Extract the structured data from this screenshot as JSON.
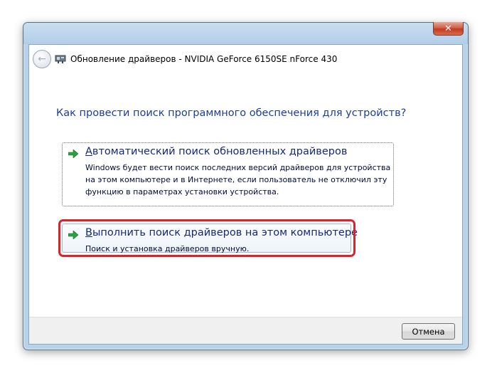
{
  "window": {
    "title": "Обновление драйверов - NVIDIA GeForce 6150SE nForce 430",
    "close_glyph": "✕"
  },
  "nav": {
    "back_glyph": "←"
  },
  "main_instruction": "Как провести поиск программного обеспечения для устройств?",
  "options": [
    {
      "title_underlined": "А",
      "title_rest": "втоматический поиск обновленных драйверов",
      "description": "Windows будет вести поиск последних версий драйверов для устройства на этом компьютере и в Интернете, если пользователь не отключил эту функцию в параметрах установки устройства."
    },
    {
      "title_underlined": "В",
      "title_rest": "ыполнить поиск драйверов на этом компьютере",
      "description": "Поиск и установка драйверов вручную."
    }
  ],
  "buttons": {
    "cancel": "Отмена"
  },
  "colors": {
    "instruction": "#1a3e9c",
    "option_title": "#14287a",
    "arrow_green": "#2ea043",
    "highlight": "#d7262b"
  },
  "icons": {
    "option_arrow": "green-arrow-icon",
    "back": "back-arrow-icon",
    "device": "device-icon",
    "close": "close-icon"
  }
}
